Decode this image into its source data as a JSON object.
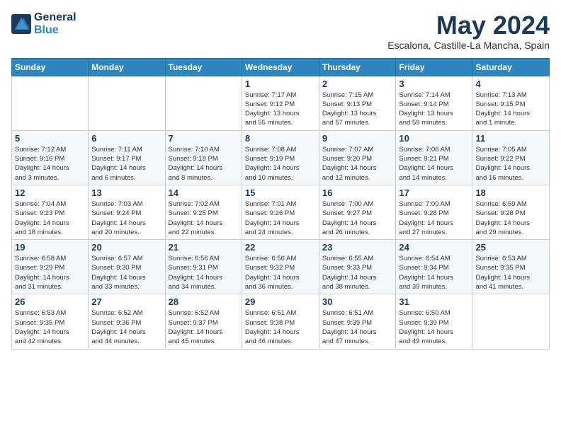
{
  "header": {
    "logo_line1": "General",
    "logo_line2": "Blue",
    "month_title": "May 2024",
    "location": "Escalona, Castille-La Mancha, Spain"
  },
  "weekdays": [
    "Sunday",
    "Monday",
    "Tuesday",
    "Wednesday",
    "Thursday",
    "Friday",
    "Saturday"
  ],
  "weeks": [
    [
      {
        "day": "",
        "info": ""
      },
      {
        "day": "",
        "info": ""
      },
      {
        "day": "",
        "info": ""
      },
      {
        "day": "1",
        "info": "Sunrise: 7:17 AM\nSunset: 9:12 PM\nDaylight: 13 hours\nand 55 minutes."
      },
      {
        "day": "2",
        "info": "Sunrise: 7:15 AM\nSunset: 9:13 PM\nDaylight: 13 hours\nand 57 minutes."
      },
      {
        "day": "3",
        "info": "Sunrise: 7:14 AM\nSunset: 9:14 PM\nDaylight: 13 hours\nand 59 minutes."
      },
      {
        "day": "4",
        "info": "Sunrise: 7:13 AM\nSunset: 9:15 PM\nDaylight: 14 hours\nand 1 minute."
      }
    ],
    [
      {
        "day": "5",
        "info": "Sunrise: 7:12 AM\nSunset: 9:16 PM\nDaylight: 14 hours\nand 3 minutes."
      },
      {
        "day": "6",
        "info": "Sunrise: 7:11 AM\nSunset: 9:17 PM\nDaylight: 14 hours\nand 6 minutes."
      },
      {
        "day": "7",
        "info": "Sunrise: 7:10 AM\nSunset: 9:18 PM\nDaylight: 14 hours\nand 8 minutes."
      },
      {
        "day": "8",
        "info": "Sunrise: 7:08 AM\nSunset: 9:19 PM\nDaylight: 14 hours\nand 10 minutes."
      },
      {
        "day": "9",
        "info": "Sunrise: 7:07 AM\nSunset: 9:20 PM\nDaylight: 14 hours\nand 12 minutes."
      },
      {
        "day": "10",
        "info": "Sunrise: 7:06 AM\nSunset: 9:21 PM\nDaylight: 14 hours\nand 14 minutes."
      },
      {
        "day": "11",
        "info": "Sunrise: 7:05 AM\nSunset: 9:22 PM\nDaylight: 14 hours\nand 16 minutes."
      }
    ],
    [
      {
        "day": "12",
        "info": "Sunrise: 7:04 AM\nSunset: 9:23 PM\nDaylight: 14 hours\nand 18 minutes."
      },
      {
        "day": "13",
        "info": "Sunrise: 7:03 AM\nSunset: 9:24 PM\nDaylight: 14 hours\nand 20 minutes."
      },
      {
        "day": "14",
        "info": "Sunrise: 7:02 AM\nSunset: 9:25 PM\nDaylight: 14 hours\nand 22 minutes."
      },
      {
        "day": "15",
        "info": "Sunrise: 7:01 AM\nSunset: 9:26 PM\nDaylight: 14 hours\nand 24 minutes."
      },
      {
        "day": "16",
        "info": "Sunrise: 7:00 AM\nSunset: 9:27 PM\nDaylight: 14 hours\nand 26 minutes."
      },
      {
        "day": "17",
        "info": "Sunrise: 7:00 AM\nSunset: 9:28 PM\nDaylight: 14 hours\nand 27 minutes."
      },
      {
        "day": "18",
        "info": "Sunrise: 6:59 AM\nSunset: 9:28 PM\nDaylight: 14 hours\nand 29 minutes."
      }
    ],
    [
      {
        "day": "19",
        "info": "Sunrise: 6:58 AM\nSunset: 9:29 PM\nDaylight: 14 hours\nand 31 minutes."
      },
      {
        "day": "20",
        "info": "Sunrise: 6:57 AM\nSunset: 9:30 PM\nDaylight: 14 hours\nand 33 minutes."
      },
      {
        "day": "21",
        "info": "Sunrise: 6:56 AM\nSunset: 9:31 PM\nDaylight: 14 hours\nand 34 minutes."
      },
      {
        "day": "22",
        "info": "Sunrise: 6:56 AM\nSunset: 9:32 PM\nDaylight: 14 hours\nand 36 minutes."
      },
      {
        "day": "23",
        "info": "Sunrise: 6:55 AM\nSunset: 9:33 PM\nDaylight: 14 hours\nand 38 minutes."
      },
      {
        "day": "24",
        "info": "Sunrise: 6:54 AM\nSunset: 9:34 PM\nDaylight: 14 hours\nand 39 minutes."
      },
      {
        "day": "25",
        "info": "Sunrise: 6:53 AM\nSunset: 9:35 PM\nDaylight: 14 hours\nand 41 minutes."
      }
    ],
    [
      {
        "day": "26",
        "info": "Sunrise: 6:53 AM\nSunset: 9:35 PM\nDaylight: 14 hours\nand 42 minutes."
      },
      {
        "day": "27",
        "info": "Sunrise: 6:52 AM\nSunset: 9:36 PM\nDaylight: 14 hours\nand 44 minutes."
      },
      {
        "day": "28",
        "info": "Sunrise: 6:52 AM\nSunset: 9:37 PM\nDaylight: 14 hours\nand 45 minutes."
      },
      {
        "day": "29",
        "info": "Sunrise: 6:51 AM\nSunset: 9:38 PM\nDaylight: 14 hours\nand 46 minutes."
      },
      {
        "day": "30",
        "info": "Sunrise: 6:51 AM\nSunset: 9:39 PM\nDaylight: 14 hours\nand 47 minutes."
      },
      {
        "day": "31",
        "info": "Sunrise: 6:50 AM\nSunset: 9:39 PM\nDaylight: 14 hours\nand 49 minutes."
      },
      {
        "day": "",
        "info": ""
      }
    ]
  ]
}
